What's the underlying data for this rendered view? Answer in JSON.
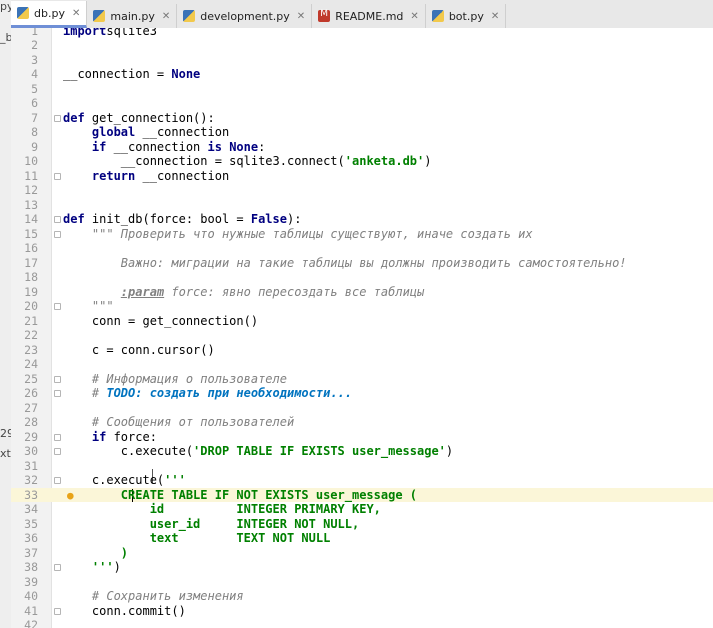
{
  "left_strip_fragments": [
    "py",
    "_b",
    "29",
    "xt"
  ],
  "tabs": [
    {
      "label": "db.py",
      "icon": "python-file-icon",
      "active": true
    },
    {
      "label": "main.py",
      "icon": "python-file-icon",
      "active": false
    },
    {
      "label": "development.py",
      "icon": "python-file-icon",
      "active": false
    },
    {
      "label": "README.md",
      "icon": "markdown-file-icon",
      "active": false
    },
    {
      "label": "bot.py",
      "icon": "python-file-icon",
      "active": false
    }
  ],
  "current_line": 33,
  "lines": [
    {
      "n": "1",
      "tokens": [
        [
          "kw",
          "import"
        ],
        [
          "",
          "sqlite3"
        ]
      ]
    },
    {
      "n": "2",
      "tokens": []
    },
    {
      "n": "3",
      "tokens": []
    },
    {
      "n": "4",
      "tokens": [
        [
          "",
          "__connection = "
        ],
        [
          "kw",
          "None"
        ]
      ]
    },
    {
      "n": "5",
      "tokens": []
    },
    {
      "n": "6",
      "tokens": []
    },
    {
      "n": "7",
      "fold": true,
      "tokens": [
        [
          "kw",
          "def"
        ],
        [
          "",
          " get_connection():"
        ]
      ]
    },
    {
      "n": "8",
      "tokens": [
        [
          "",
          "    "
        ],
        [
          "kw",
          "global"
        ],
        [
          "",
          " __connection"
        ]
      ]
    },
    {
      "n": "9",
      "tokens": [
        [
          "",
          "    "
        ],
        [
          "kw",
          "if"
        ],
        [
          "",
          " __connection "
        ],
        [
          "kw",
          "is None"
        ],
        [
          "",
          ":"
        ]
      ]
    },
    {
      "n": "10",
      "tokens": [
        [
          "",
          "        __connection = sqlite3.connect("
        ],
        [
          "str",
          "'anketa.db'"
        ],
        [
          "",
          ")"
        ]
      ]
    },
    {
      "n": "11",
      "fold": true,
      "tokens": [
        [
          "",
          "    "
        ],
        [
          "kw",
          "return"
        ],
        [
          "",
          " __connection"
        ]
      ]
    },
    {
      "n": "12",
      "tokens": []
    },
    {
      "n": "13",
      "tokens": []
    },
    {
      "n": "14",
      "fold": true,
      "tokens": [
        [
          "kw",
          "def"
        ],
        [
          "",
          " init_db(force: bool = "
        ],
        [
          "kw",
          "False"
        ],
        [
          "",
          "):"
        ]
      ]
    },
    {
      "n": "15",
      "fold": true,
      "tokens": [
        [
          "",
          "    "
        ],
        [
          "doc",
          "\"\"\" Проверить что нужные таблицы существуют, иначе создать их"
        ]
      ]
    },
    {
      "n": "16",
      "tokens": []
    },
    {
      "n": "17",
      "tokens": [
        [
          "",
          "        "
        ],
        [
          "doc",
          "Важно: миграции на такие таблицы вы должны производить самостоятельно!"
        ]
      ]
    },
    {
      "n": "18",
      "tokens": []
    },
    {
      "n": "19",
      "tokens": [
        [
          "",
          "        "
        ],
        [
          "doctag",
          ":param"
        ],
        [
          "doc",
          " force: явно пересоздать все таблицы"
        ]
      ]
    },
    {
      "n": "20",
      "fold": true,
      "tokens": [
        [
          "",
          "    "
        ],
        [
          "doc",
          "\"\"\""
        ]
      ]
    },
    {
      "n": "21",
      "tokens": [
        [
          "",
          "    conn = get_connection()"
        ]
      ]
    },
    {
      "n": "22",
      "tokens": []
    },
    {
      "n": "23",
      "tokens": [
        [
          "",
          "    c = conn.cursor()"
        ]
      ]
    },
    {
      "n": "24",
      "tokens": []
    },
    {
      "n": "25",
      "fold": true,
      "tokens": [
        [
          "",
          "    "
        ],
        [
          "cm",
          "# Информация о пользователе"
        ]
      ]
    },
    {
      "n": "26",
      "fold": true,
      "tokens": [
        [
          "",
          "    "
        ],
        [
          "cm",
          "# "
        ],
        [
          "todo",
          "TODO: создать при необходимости..."
        ]
      ]
    },
    {
      "n": "27",
      "tokens": []
    },
    {
      "n": "28",
      "tokens": [
        [
          "",
          "    "
        ],
        [
          "cm",
          "# Сообщения от пользователей"
        ]
      ]
    },
    {
      "n": "29",
      "fold": true,
      "tokens": [
        [
          "",
          "    "
        ],
        [
          "kw",
          "if"
        ],
        [
          "",
          " force:"
        ]
      ]
    },
    {
      "n": "30",
      "fold": true,
      "tokens": [
        [
          "",
          "        c.execute("
        ],
        [
          "str",
          "'DROP TABLE IF EXISTS user_message'"
        ],
        [
          "",
          ")"
        ]
      ]
    },
    {
      "n": "31",
      "tokens": []
    },
    {
      "n": "32",
      "fold": true,
      "tokens": [
        [
          "",
          "    c.execute("
        ],
        [
          "str",
          "'''"
        ]
      ]
    },
    {
      "n": "33",
      "bulb": true,
      "tokens": [
        [
          "",
          "        "
        ],
        [
          "str",
          "CREATE TABLE IF NOT EXISTS user_message ("
        ]
      ]
    },
    {
      "n": "34",
      "tokens": [
        [
          "",
          "            "
        ],
        [
          "str",
          "id          INTEGER PRIMARY KEY,"
        ]
      ]
    },
    {
      "n": "35",
      "tokens": [
        [
          "",
          "            "
        ],
        [
          "str",
          "user_id     INTEGER NOT NULL,"
        ]
      ]
    },
    {
      "n": "36",
      "tokens": [
        [
          "",
          "            "
        ],
        [
          "str",
          "text        TEXT NOT NULL"
        ]
      ]
    },
    {
      "n": "37",
      "tokens": [
        [
          "",
          "        "
        ],
        [
          "str",
          ")"
        ]
      ]
    },
    {
      "n": "38",
      "fold": true,
      "tokens": [
        [
          "",
          "    "
        ],
        [
          "str",
          "'''"
        ],
        [
          "",
          ")"
        ]
      ]
    },
    {
      "n": "39",
      "tokens": []
    },
    {
      "n": "40",
      "tokens": [
        [
          "",
          "    "
        ],
        [
          "cm",
          "# Сохранить изменения"
        ]
      ]
    },
    {
      "n": "41",
      "fold": true,
      "tokens": [
        [
          "",
          "    conn.commit()"
        ]
      ]
    },
    {
      "n": "42",
      "tokens": []
    }
  ]
}
